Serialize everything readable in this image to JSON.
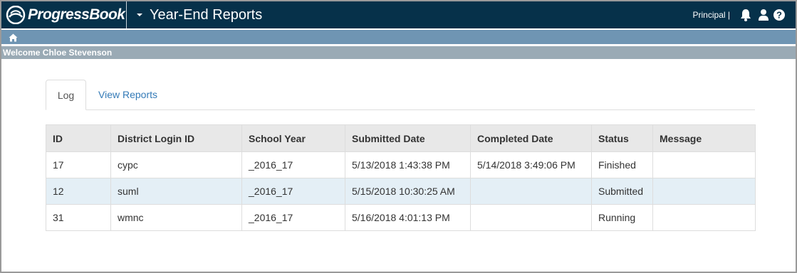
{
  "header": {
    "brand": "ProgressBook",
    "app_title": "Year-End Reports",
    "role": "Principal |",
    "icons": [
      "bell-icon",
      "user-icon",
      "help-icon"
    ]
  },
  "nav": {
    "home_icon": "home-icon"
  },
  "welcome": "Welcome Chloe Stevenson",
  "tabs": [
    {
      "label": "Log",
      "active": true
    },
    {
      "label": "View Reports",
      "active": false
    }
  ],
  "table": {
    "columns": [
      "ID",
      "District Login ID",
      "School Year",
      "Submitted Date",
      "Completed Date",
      "Status",
      "Message"
    ],
    "rows": [
      [
        "17",
        "cypc",
        "_2016_17",
        "5/13/2018 1:43:38 PM",
        "5/14/2018 3:49:06 PM",
        "Finished",
        ""
      ],
      [
        "12",
        "suml",
        "_2016_17",
        "5/15/2018 10:30:25 AM",
        "",
        "Submitted",
        ""
      ],
      [
        "31",
        "wmnc",
        "_2016_17",
        "5/16/2018 4:01:13 PM",
        "",
        "Running",
        ""
      ]
    ]
  },
  "colors": {
    "header_bg": "#06314a",
    "nav_bg": "#6f95b3",
    "welcome_bg": "#9aaab5",
    "link": "#337ab7",
    "highlight_row": "#e4eff6"
  }
}
